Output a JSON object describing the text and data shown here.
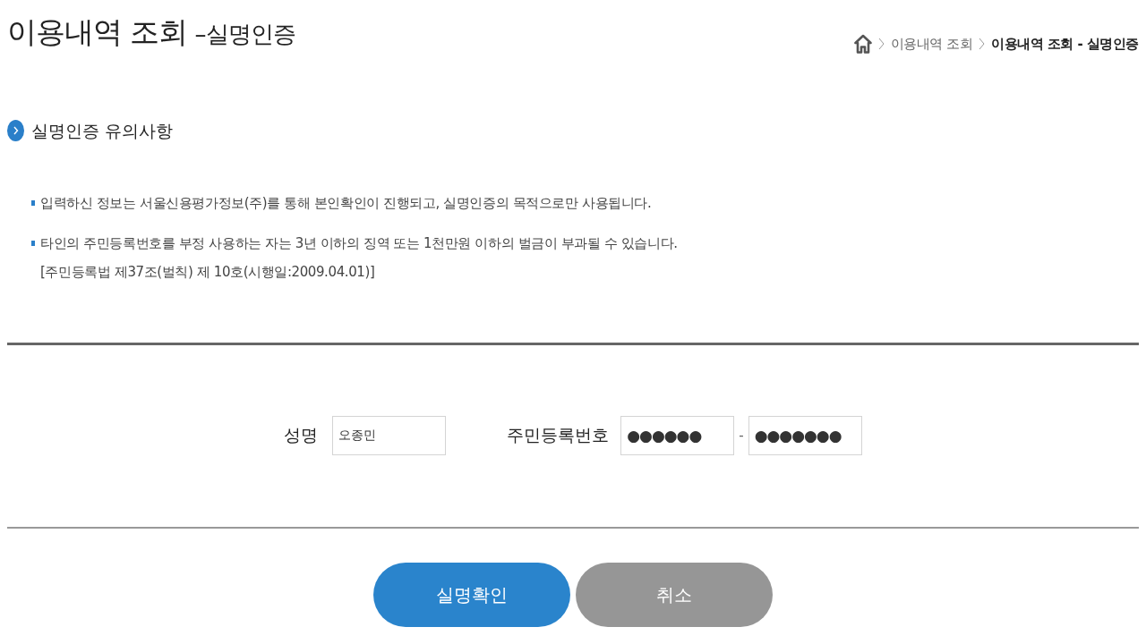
{
  "header": {
    "title": "이용내역 조회",
    "subtitle": "–실명인증"
  },
  "breadcrumb": [
    {
      "label": "이용내역 조회",
      "current": false
    },
    {
      "label": "이용내역 조회 - 실명인증",
      "current": true
    }
  ],
  "notice": {
    "heading": "실명인증 유의사항",
    "items": [
      {
        "lines": [
          "입력하신 정보는 서울신용평가정보(주)를 통해 본인확인이 진행되고, 실명인증의 목적으로만 사용됩니다."
        ]
      },
      {
        "lines": [
          "타인의 주민등록번호를 부정 사용하는 자는 3년 이하의 징역 또는 1천만원 이하의 벌금이 부과될 수 있습니다.",
          "[주민등록법 제37조(벌칙) 제 10호(시행일:2009.04.01)]"
        ]
      }
    ]
  },
  "form": {
    "name_field": {
      "label": "성명",
      "value": "오종민"
    },
    "id_field": {
      "label": "주민등록번호",
      "first": "●●●●●●",
      "separator": "-",
      "second": "●●●●●●●"
    }
  },
  "buttons": [
    {
      "label": "실명확인",
      "kind": "primary"
    },
    {
      "label": "취소",
      "kind": "secondary"
    }
  ]
}
